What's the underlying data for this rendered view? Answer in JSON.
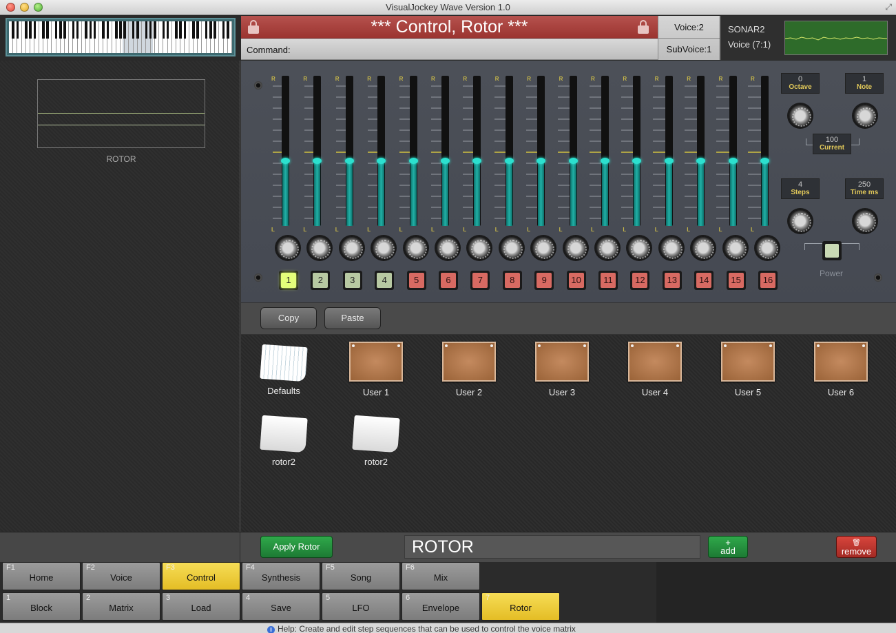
{
  "window": {
    "title": "VisualJockey Wave Version 1.0"
  },
  "header": {
    "banner_title": "*** Control, Rotor ***",
    "command_label": "Command:",
    "voice": "Voice:2",
    "subvoice": "SubVoice:1",
    "sonar_name": "SONAR2",
    "sonar_voice": "Voice (7:1)"
  },
  "preview": {
    "label": "ROTOR"
  },
  "sequencer": {
    "slider_top_label": "R",
    "slider_bottom_label": "L",
    "slider_levels": [
      0.5,
      0.5,
      0.5,
      0.5,
      0.5,
      0.5,
      0.5,
      0.5,
      0.5,
      0.5,
      0.5,
      0.5,
      0.5,
      0.5,
      0.5,
      0.5
    ],
    "steps": [
      {
        "label": "1",
        "state": "active"
      },
      {
        "label": "2",
        "state": "green"
      },
      {
        "label": "3",
        "state": "green"
      },
      {
        "label": "4",
        "state": "green"
      },
      {
        "label": "5",
        "state": "red"
      },
      {
        "label": "6",
        "state": "red"
      },
      {
        "label": "7",
        "state": "red"
      },
      {
        "label": "8",
        "state": "red"
      },
      {
        "label": "9",
        "state": "red"
      },
      {
        "label": "10",
        "state": "red"
      },
      {
        "label": "11",
        "state": "red"
      },
      {
        "label": "12",
        "state": "red"
      },
      {
        "label": "13",
        "state": "red"
      },
      {
        "label": "14",
        "state": "red"
      },
      {
        "label": "15",
        "state": "red"
      },
      {
        "label": "16",
        "state": "red"
      }
    ],
    "octave": {
      "value": "0",
      "label": "Octave"
    },
    "note": {
      "value": "1",
      "label": "Note"
    },
    "current": {
      "value": "100",
      "label": "Current"
    },
    "steps_count": {
      "value": "4",
      "label": "Steps"
    },
    "time": {
      "value": "250",
      "label": "Time ms"
    },
    "power_label": "Power"
  },
  "toolbar": {
    "copy": "Copy",
    "paste": "Paste"
  },
  "presets": [
    {
      "label": "Defaults",
      "kind": "defaults"
    },
    {
      "label": "User 1",
      "kind": "cork"
    },
    {
      "label": "User 2",
      "kind": "cork"
    },
    {
      "label": "User 3",
      "kind": "cork"
    },
    {
      "label": "User 4",
      "kind": "cork"
    },
    {
      "label": "User 5",
      "kind": "cork"
    },
    {
      "label": "User 6",
      "kind": "cork"
    },
    {
      "label": "rotor2",
      "kind": "paper"
    },
    {
      "label": "rotor2",
      "kind": "paper"
    }
  ],
  "actions": {
    "apply": "Apply Rotor",
    "name_value": "ROTOR",
    "add_symbol": "+",
    "add": "add",
    "remove": "remove"
  },
  "fkeys_row1": [
    {
      "num": "F1",
      "label": "Home",
      "active": false
    },
    {
      "num": "F2",
      "label": "Voice",
      "active": false
    },
    {
      "num": "F3",
      "label": "Control",
      "active": true
    },
    {
      "num": "F4",
      "label": "Synthesis",
      "active": false
    },
    {
      "num": "F5",
      "label": "Song",
      "active": false
    },
    {
      "num": "F6",
      "label": "Mix",
      "active": false
    }
  ],
  "fkeys_row2": [
    {
      "num": "1",
      "label": "Block",
      "active": false
    },
    {
      "num": "2",
      "label": "Matrix",
      "active": false
    },
    {
      "num": "3",
      "label": "Load",
      "active": false
    },
    {
      "num": "4",
      "label": "Save",
      "active": false
    },
    {
      "num": "5",
      "label": "LFO",
      "active": false
    },
    {
      "num": "6",
      "label": "Envelope",
      "active": false
    },
    {
      "num": "7",
      "label": "Rotor",
      "active": true
    }
  ],
  "status": {
    "help": "Help: Create and edit step sequences that can be used to control the voice matrix"
  }
}
